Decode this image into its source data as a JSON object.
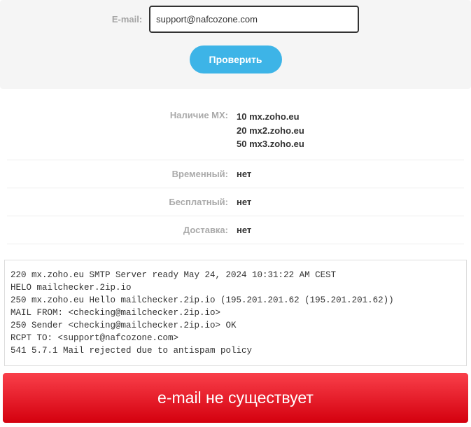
{
  "form": {
    "email_label": "E-mail:",
    "email_value": "support@nafcozone.com",
    "check_button": "Проверить"
  },
  "results": {
    "mx_label": "Наличие MX:",
    "mx_records": [
      {
        "priority": "10",
        "host": "mx.zoho.eu"
      },
      {
        "priority": "20",
        "host": "mx2.zoho.eu"
      },
      {
        "priority": "50",
        "host": "mx3.zoho.eu"
      }
    ],
    "temporary_label": "Временный:",
    "temporary_value": "нет",
    "free_label": "Бесплатный:",
    "free_value": "нет",
    "delivery_label": "Доставка:",
    "delivery_value": "нет"
  },
  "smtp_log": "220 mx.zoho.eu SMTP Server ready May 24, 2024 10:31:22 AM CEST\nHELO mailchecker.2ip.io\n250 mx.zoho.eu Hello mailchecker.2ip.io (195.201.201.62 (195.201.201.62))\nMAIL FROM: <checking@mailchecker.2ip.io>\n250 Sender <checking@mailchecker.2ip.io> OK\nRCPT TO: <support@nafcozone.com>\n541 5.7.1 Mail rejected due to antispam policy",
  "status_banner": "e-mail не существует"
}
